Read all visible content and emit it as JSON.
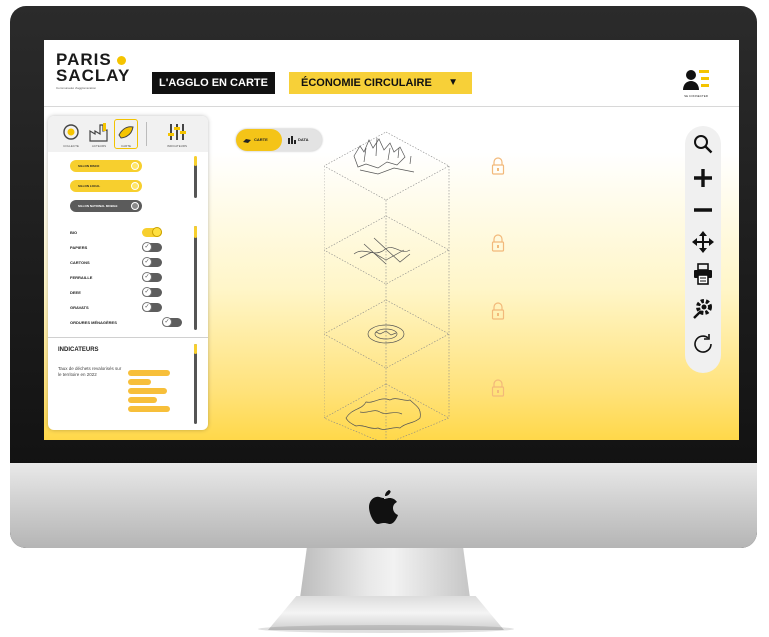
{
  "brand": {
    "line1": "PARIS",
    "line2": "SACLAY",
    "subtitle": "Communauté d'agglomération",
    "accent_color": "#f5c400"
  },
  "header": {
    "agglo_tab": "L'AGGLO EN CARTE",
    "theme_select": "ÉCONOMIE CIRCULAIRE",
    "theme_caret": "▼",
    "user_icon": "user-menu-icon",
    "user_caption": "SE CONNECTER"
  },
  "panel": {
    "top_icons": [
      {
        "icon": "recycling-icon",
        "label": "COLLECTE"
      },
      {
        "icon": "factory-icon",
        "label": "ACTEURS"
      },
      {
        "icon": "map-layer-icon",
        "label": "CARTE"
      },
      {
        "icon": "sliders-icon",
        "label": "INDICATEURS"
      }
    ],
    "filters": [
      {
        "label": "SILLON DISCO",
        "state": "on"
      },
      {
        "label": "SILLON LOCAL",
        "state": "on"
      },
      {
        "label": "SILLON NATIONAL MOBILE",
        "state": "off"
      }
    ],
    "items": [
      {
        "label": "BIO",
        "checked": true
      },
      {
        "label": "PAPIERS",
        "checked": false
      },
      {
        "label": "CARTONS",
        "checked": false
      },
      {
        "label": "FERRAILLE",
        "checked": false
      },
      {
        "label": "DEEE",
        "checked": false
      },
      {
        "label": "GRAVATS",
        "checked": false
      },
      {
        "label": "ORDURES MÉNAGÈRES",
        "checked": false
      }
    ],
    "indicators_title": "INDICATEURS",
    "indicators_desc": "Taux de déchets revalorisés sur le territoire en 2022",
    "indicator_values": [
      0.8,
      0.45,
      0.75,
      0.55,
      0.8
    ]
  },
  "mode_toggle": {
    "left_label": "CARTE",
    "right_label": "DATA",
    "active": "CARTE"
  },
  "toolbar": {
    "tools": [
      "search-icon",
      "zoom-in-icon",
      "zoom-out-icon",
      "pan-icon",
      "print-icon",
      "settings-icon",
      "refresh-icon"
    ]
  },
  "colors": {
    "yellow": "#f7cf2e",
    "dark": "#111111",
    "grey_toggle": "#5d5d5d"
  }
}
